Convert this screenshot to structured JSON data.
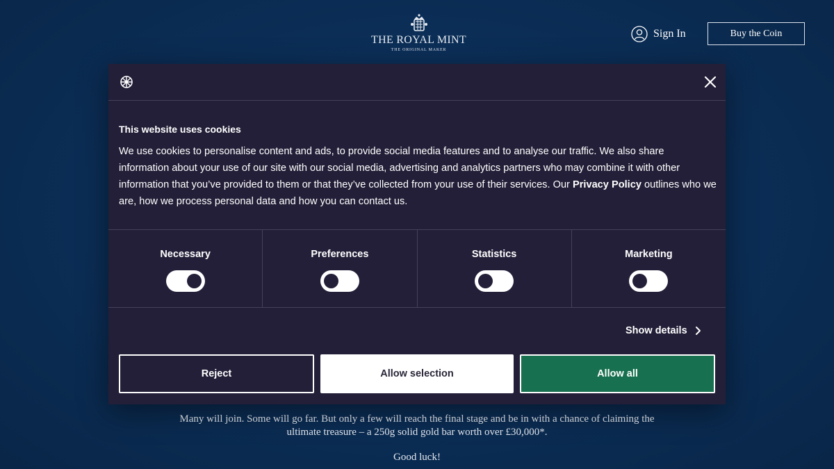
{
  "header": {
    "brand": "THE ROYAL MINT",
    "brand_sub": "THE ORIGINAL MAKER",
    "sign_in": "Sign In",
    "buy_button": "Buy the Coin"
  },
  "page": {
    "body_text": "Many will join. Some will go far. But only a few will reach the final stage and be in with a chance of claiming the ultimate treasure – a 250g solid gold bar worth over £30,000*.",
    "good_luck": "Good luck!"
  },
  "cookie_dialog": {
    "title": "This website uses cookies",
    "text_before_link": "We use cookies to personalise content and ads, to provide social media features and to analyse our traffic. We also share information about your use of our site with our social media, advertising and analytics partners who may combine it with other information that you’ve provided to them or that they’ve collected from your use of their services. Our ",
    "privacy_link": "Privacy Policy",
    "text_after_link": " outlines who we are, how we process personal data and how you can contact us.",
    "toggles": [
      {
        "label": "Necessary",
        "on": true
      },
      {
        "label": "Preferences",
        "on": false
      },
      {
        "label": "Statistics",
        "on": false
      },
      {
        "label": "Marketing",
        "on": false
      }
    ],
    "show_details": "Show details",
    "buttons": {
      "reject": "Reject",
      "allow_selection": "Allow selection",
      "allow_all": "Allow all"
    }
  },
  "colors": {
    "page_background": "#0b2d55",
    "dialog_background": "#241f38",
    "allow_all": "#17704f"
  },
  "icons": [
    "crest-logo-icon",
    "user-icon",
    "cookiebot-logo-icon",
    "close-icon",
    "chevron-right-icon"
  ]
}
